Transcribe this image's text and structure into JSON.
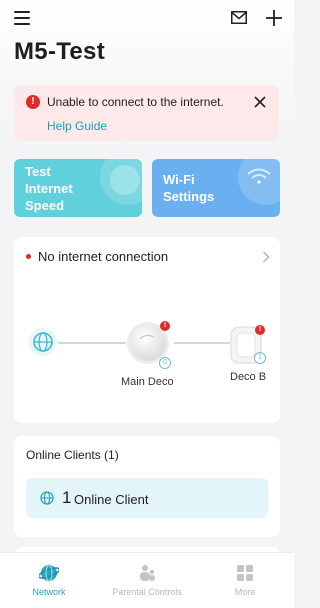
{
  "header": {
    "title": "M5-Test",
    "icons": [
      "menu-icon",
      "mail-icon",
      "plus-icon"
    ]
  },
  "alert": {
    "message": "Unable to connect to the internet.",
    "link": "Help Guide",
    "icon": "!",
    "color": "#e12b2b"
  },
  "tiles": [
    {
      "label": "Test Internet Speed",
      "lines": [
        "Test",
        "Internet",
        "Speed"
      ],
      "color": "#5fd0dc",
      "icon": "speedometer-icon"
    },
    {
      "label": "Wi-Fi Settings",
      "lines": [
        "Wi-Fi",
        "Settings"
      ],
      "color": "#6aaff0",
      "icon": "wifi-icon"
    }
  ],
  "network": {
    "status": "No internet connection",
    "nodes": [
      {
        "label": "Main Deco",
        "badge": "!",
        "count": "0"
      },
      {
        "label": "Deco B",
        "badge": "!",
        "count": "1"
      }
    ]
  },
  "clients": {
    "title": "Online Clients (1)",
    "count": "1",
    "label": "Online Client"
  },
  "nav": [
    {
      "label": "Network",
      "icon": "network-icon",
      "active": true
    },
    {
      "label": "Parental Controls",
      "icon": "parental-controls-icon",
      "active": false
    },
    {
      "label": "More",
      "icon": "grid-icon",
      "active": false
    }
  ],
  "colors": {
    "accent": "#2aa6c1",
    "alert_bg": "#fde9e9",
    "error": "#e12b2b"
  }
}
